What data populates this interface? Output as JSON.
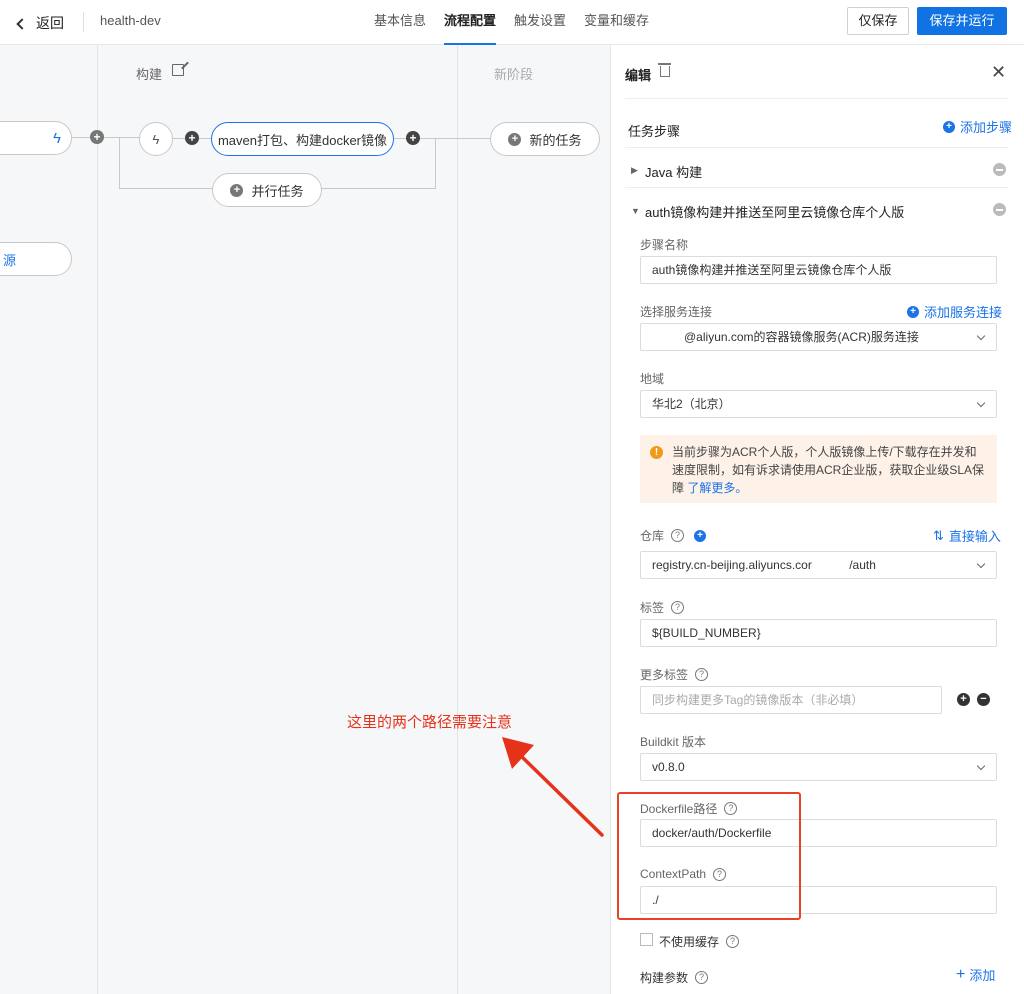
{
  "header": {
    "back_label": "返回",
    "project": "health-dev",
    "tabs": [
      "基本信息",
      "流程配置",
      "触发设置",
      "变量和缓存"
    ],
    "active_tab": "流程配置",
    "save_only": "仅保存",
    "save_run": "保存并运行"
  },
  "canvas": {
    "stage_build": "构建",
    "stage_new": "新阶段",
    "job_name": "maven打包、构建docker镜像",
    "new_task": "新的任务",
    "parallel_task": "并行任务",
    "left_fragment": "源",
    "annotation": "这里的两个路径需要注意"
  },
  "panel": {
    "title": "编辑",
    "steps_label": "任务步骤",
    "add_step": "添加步骤",
    "step1": "Java 构建",
    "step2": "auth镜像构建并推送至阿里云镜像仓库个人版",
    "step_name_label": "步骤名称",
    "step_name_value": "auth镜像构建并推送至阿里云镜像仓库个人版",
    "service_conn_label": "选择服务连接",
    "add_service_conn": "添加服务连接",
    "service_conn_value": "@aliyun.com的容器镜像服务(ACR)服务连接",
    "region_label": "地域",
    "region_value": "华北2（北京）",
    "warning_text": "当前步骤为ACR个人版，个人版镜像上传/下载存在并发和速度限制，如有诉求请使用ACR企业版，获取企业级SLA保障",
    "warning_link": "了解更多。",
    "repo_label": "仓库",
    "direct_input": "直接输入",
    "repo_value_a": "registry.cn-beijing.aliyuncs.cor",
    "repo_value_b": "/auth",
    "tag_label": "标签",
    "tag_value": "${BUILD_NUMBER}",
    "more_tags_label": "更多标签",
    "more_tags_placeholder": "同步构建更多Tag的镜像版本（非必填）",
    "buildkit_label": "Buildkit 版本",
    "buildkit_value": "v0.8.0",
    "dockerfile_label": "Dockerfile路径",
    "dockerfile_value": "docker/auth/Dockerfile",
    "context_label": "ContextPath",
    "context_value": "./",
    "no_cache_label": "不使用缓存",
    "build_args_label": "构建参数",
    "add_label": "添加"
  },
  "colors": {
    "primary": "#1172e3",
    "annotation": "#e5331a",
    "warning_bg": "#fdf1e8",
    "warning_icon": "#f09a1a"
  }
}
